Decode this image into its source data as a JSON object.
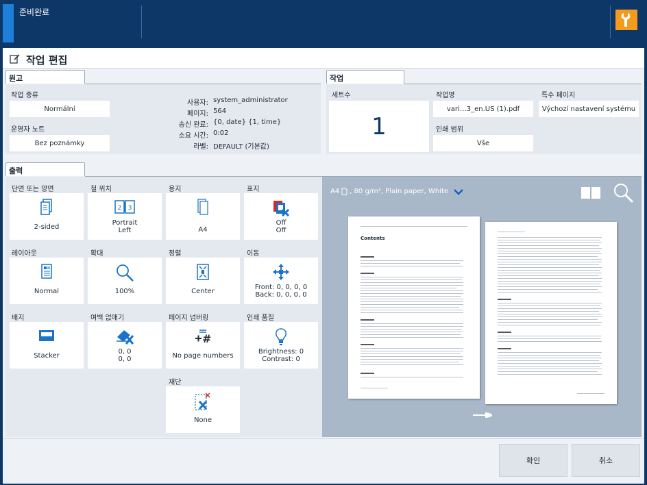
{
  "topbar": {
    "status": "준비완료"
  },
  "page": {
    "title": "작업 편집"
  },
  "original": {
    "tab": "원고",
    "job_type_label": "작업 종류",
    "job_type_value": "Normální",
    "operator_note_label": "운영자 노트",
    "operator_note_value": "Bez poznámky",
    "info": [
      {
        "key": "사용자:",
        "value": "system_administrator"
      },
      {
        "key": "페이지:",
        "value": "564"
      },
      {
        "key": "송신 완료:",
        "value": "{0, date} {1, time}"
      },
      {
        "key": "소요 시간:",
        "value": "0:02"
      },
      {
        "key": "라벨:",
        "value": "DEFAULT (기본값)"
      }
    ]
  },
  "job": {
    "tab": "작업",
    "copies_label": "세트수",
    "copies_value": "1",
    "job_name_label": "작업명",
    "job_name_value": "vari…3_en.US (1).pdf",
    "special_pages_label": "특수 페이지",
    "special_pages_value": "Výchozí nastavení systému",
    "print_range_label": "인쇄 범위",
    "print_range_value": "Vše"
  },
  "output": {
    "tab": "출력",
    "tiles": [
      {
        "label": "단면 또는 양면",
        "icon": "two-sided-icon",
        "line1": "2-sided",
        "line2": ""
      },
      {
        "label": "철 위치",
        "icon": "staple-position-icon",
        "line1": "Portrait",
        "line2": "Left"
      },
      {
        "label": "용지",
        "icon": "paper-icon",
        "line1": "A4",
        "line2": ""
      },
      {
        "label": "표지",
        "icon": "cover-icon",
        "line1": "Off",
        "line2": "Off"
      },
      {
        "label": "레이아웃",
        "icon": "layout-icon",
        "line1": "Normal",
        "line2": ""
      },
      {
        "label": "확대",
        "icon": "zoom-icon",
        "line1": "100%",
        "line2": ""
      },
      {
        "label": "정렬",
        "icon": "align-icon",
        "line1": "Center",
        "line2": ""
      },
      {
        "label": "이동",
        "icon": "shift-icon",
        "line1": "Front: 0, 0, 0, 0",
        "line2": "Back: 0, 0, 0, 0"
      },
      {
        "label": "배지",
        "icon": "stacker-icon",
        "line1": "Stacker",
        "line2": ""
      },
      {
        "label": "여백 없애기",
        "icon": "erase-margin-icon",
        "line1": "0, 0",
        "line2": "0, 0"
      },
      {
        "label": "페이지 넘버링",
        "icon": "page-numbering-icon",
        "line1": "No page numbers",
        "line2": ""
      },
      {
        "label": "인쇄 품질",
        "icon": "print-quality-icon",
        "line1": "Brightness: 0",
        "line2": "Contrast: 0"
      },
      {
        "label": "재단",
        "icon": "trim-icon",
        "line1": "None",
        "line2": ""
      }
    ]
  },
  "preview": {
    "paper_size": "A4",
    "paper_info": ", 80 g/m², Plain paper, White",
    "page1_title": "Contents"
  },
  "buttons": {
    "ok": "확인",
    "cancel": "취소"
  },
  "colors": {
    "accent": "#1e7fd8",
    "icon_blue": "#1a73c8",
    "header_bg": "#0d3766",
    "wrench_bg": "#f49b1e"
  }
}
